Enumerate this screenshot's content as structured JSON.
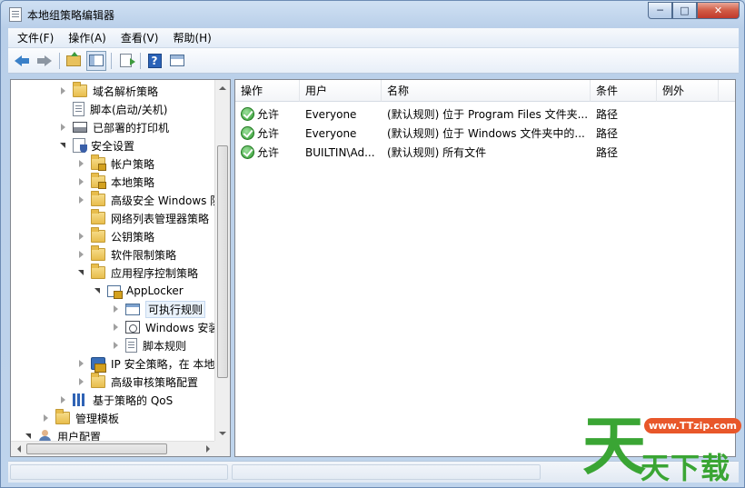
{
  "window": {
    "title": "本地组策略编辑器",
    "buttons": {
      "minimize": "─",
      "maximize": "□",
      "close": "✕"
    }
  },
  "menu": [
    "文件(F)",
    "操作(A)",
    "查看(V)",
    "帮助(H)"
  ],
  "toolbar": {
    "icons": [
      "back-arrow-icon",
      "forward-arrow-icon",
      "folder-up-icon",
      "show-hide-tree-icon",
      "export-list-icon",
      "help-icon",
      "properties-icon"
    ],
    "help_glyph": "?"
  },
  "tree": {
    "items": [
      {
        "label": "域名解析策略",
        "icon": "folder-icon",
        "twisty": "closed"
      },
      {
        "label": "脚本(启动/关机)",
        "icon": "script-icon",
        "twisty": "none"
      },
      {
        "label": "已部署的打印机",
        "icon": "printer-icon",
        "twisty": "closed"
      },
      {
        "label": "安全设置",
        "icon": "security-settings-icon",
        "twisty": "open"
      },
      {
        "label": "帐户策略",
        "icon": "folder-lock-icon",
        "twisty": "closed"
      },
      {
        "label": "本地策略",
        "icon": "folder-lock-icon",
        "twisty": "closed"
      },
      {
        "label": "高级安全 Windows 防",
        "icon": "folder-icon",
        "twisty": "closed"
      },
      {
        "label": "网络列表管理器策略",
        "icon": "folder-icon",
        "twisty": "none"
      },
      {
        "label": "公钥策略",
        "icon": "folder-icon",
        "twisty": "closed"
      },
      {
        "label": "软件限制策略",
        "icon": "folder-icon",
        "twisty": "closed"
      },
      {
        "label": "应用程序控制策略",
        "icon": "folder-icon",
        "twisty": "open"
      },
      {
        "label": "AppLocker",
        "icon": "applocker-icon",
        "twisty": "open"
      },
      {
        "label": "可执行规则",
        "icon": "executable-rules-icon",
        "twisty": "closed"
      },
      {
        "label": "Windows 安装",
        "icon": "installer-rules-icon",
        "twisty": "closed"
      },
      {
        "label": "脚本规则",
        "icon": "script-icon",
        "twisty": "closed"
      },
      {
        "label": "IP 安全策略，在 本地计",
        "icon": "ipsec-icon",
        "twisty": "closed"
      },
      {
        "label": "高级审核策略配置",
        "icon": "folder-icon",
        "twisty": "closed"
      },
      {
        "label": "基于策略的 QoS",
        "icon": "qos-icon",
        "twisty": "closed"
      },
      {
        "label": "管理模板",
        "icon": "folder-icon",
        "twisty": "closed"
      },
      {
        "label": "用户配置",
        "icon": "user-config-icon",
        "twisty": "open"
      }
    ]
  },
  "list": {
    "columns": [
      "操作",
      "用户",
      "名称",
      "条件",
      "例外"
    ],
    "rows": [
      {
        "action": "允许",
        "user": "Everyone",
        "name": "(默认规则) 位于 Program Files 文件夹...",
        "condition": "路径",
        "exception": ""
      },
      {
        "action": "允许",
        "user": "Everyone",
        "name": "(默认规则) 位于 Windows 文件夹中的...",
        "condition": "路径",
        "exception": ""
      },
      {
        "action": "允许",
        "user": "BUILTIN\\Ad...",
        "name": "(默认规则) 所有文件",
        "condition": "路径",
        "exception": ""
      }
    ]
  },
  "watermark": {
    "big": "天",
    "url": "www.TTzip.com",
    "sub": "天下载"
  },
  "colors": {
    "allow_green": "#2e9a2e",
    "selection": "#eaf2fb",
    "watermark_green": "#3aa534",
    "watermark_orange": "#e8572a"
  }
}
